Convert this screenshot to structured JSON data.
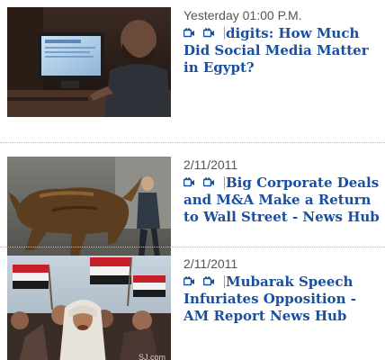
{
  "accent_color": "#1a4fa0",
  "items": [
    {
      "date": "Yesterday 01:00 P.M.",
      "title": "digits: How Much Did Social Media Matter in Egypt?",
      "icons": [
        "video-camera-icon",
        "video-camera-icon"
      ],
      "image": "person-at-computer-thumbnail"
    },
    {
      "date": "2/11/2011",
      "title": "Big Corporate Deals and M&A Make a Return to Wall Street - News Hub",
      "icons": [
        "video-camera-icon",
        "video-camera-icon"
      ],
      "image": "charging-bull-thumbnail"
    },
    {
      "date": "2/11/2011",
      "title": "Mubarak Speech Infuriates Opposition - AM Report News Hub",
      "icons": [
        "video-camera-icon",
        "video-camera-icon"
      ],
      "image": "egypt-protest-thumbnail",
      "image_watermark": "SJ.com"
    }
  ]
}
